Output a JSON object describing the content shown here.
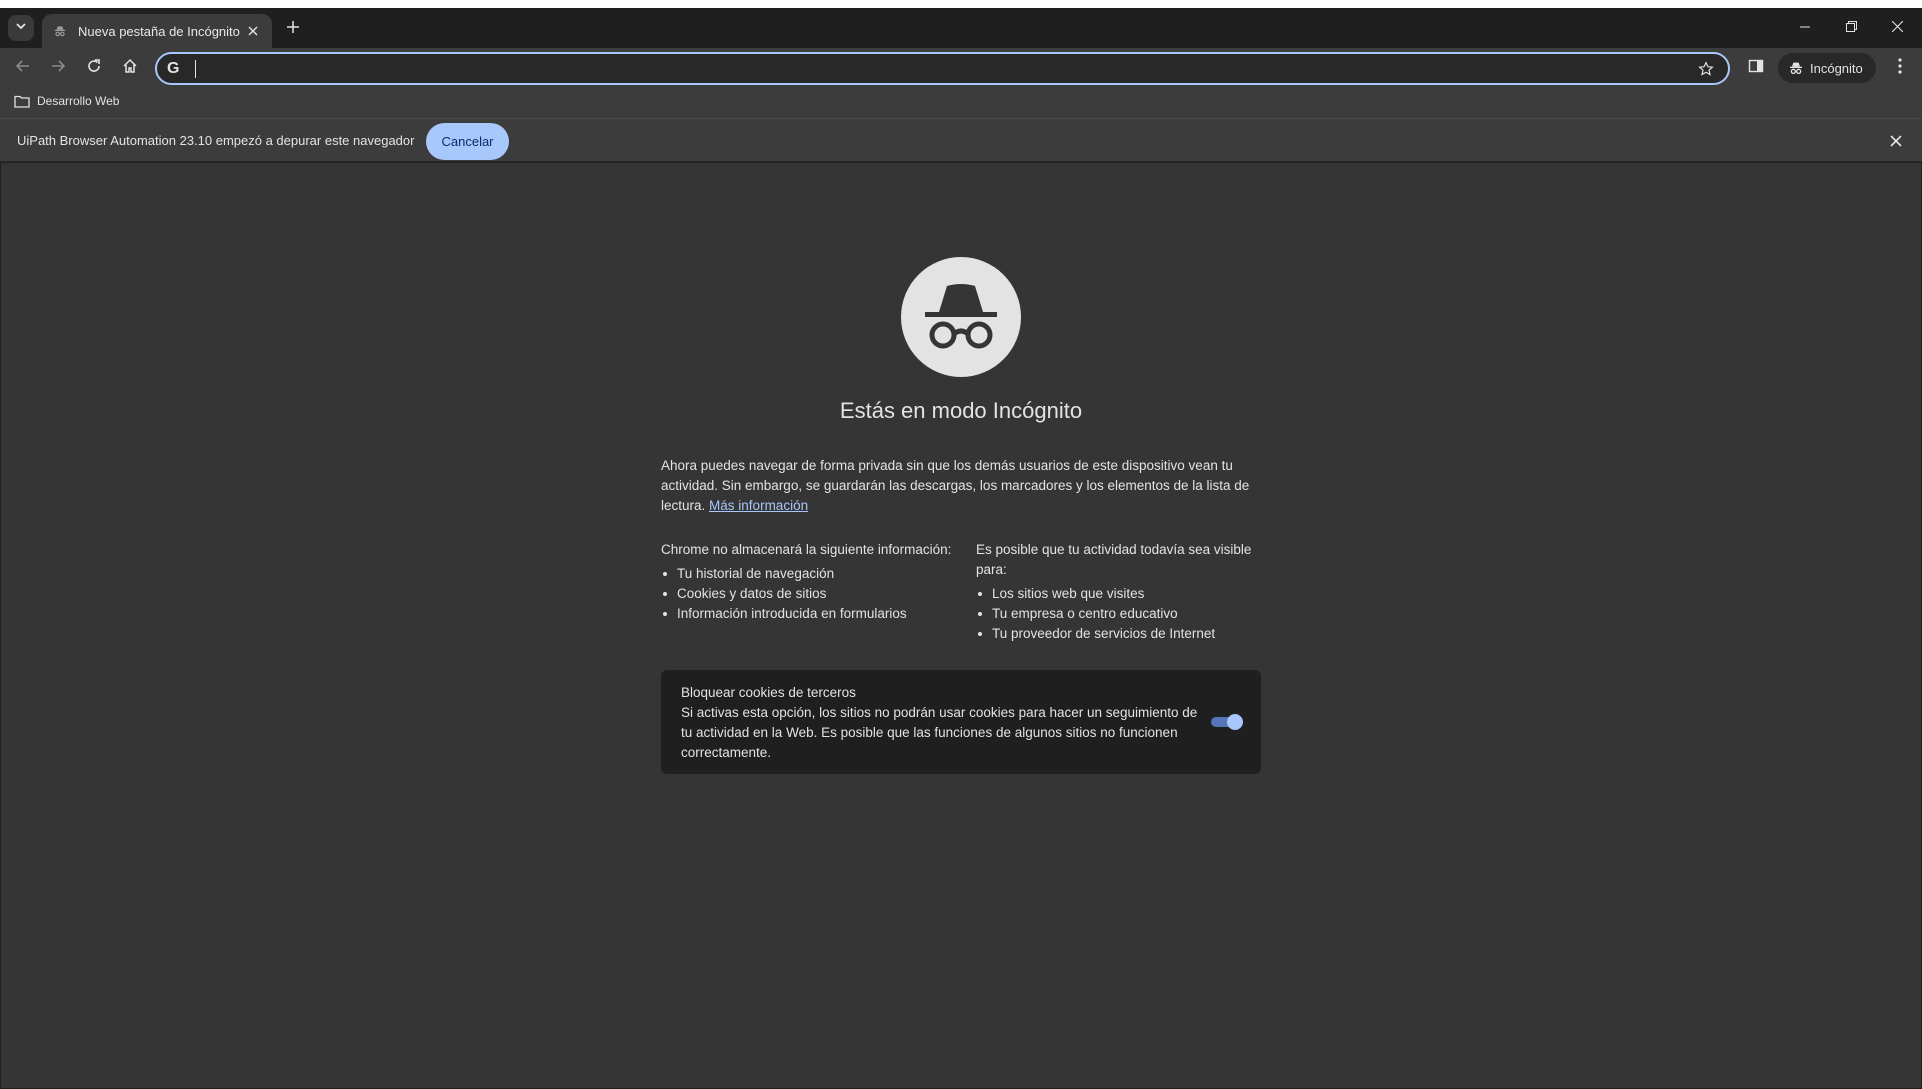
{
  "browser": {
    "tab": {
      "title": "Nueva pestaña de Incógnito"
    },
    "omnibox": {
      "value": "",
      "placeholder": ""
    },
    "profile_chip": "Incógnito",
    "bookmarks": [
      {
        "label": "Desarrollo Web"
      }
    ]
  },
  "infobar": {
    "message": "UiPath Browser Automation 23.10 empezó a depurar este navegador",
    "cancel_label": "Cancelar"
  },
  "page": {
    "heading": "Estás en modo Incógnito",
    "intro": "Ahora puedes navegar de forma privada sin que los demás usuarios de este dispositivo vean tu actividad. Sin embargo, se guardarán las descargas, los marcadores y los elementos de la lista de lectura.",
    "learn_more": "Más información",
    "left_col": {
      "heading": "Chrome no almacenará la siguiente información:",
      "items": [
        "Tu historial de navegación",
        "Cookies y datos de sitios",
        "Información introducida en formularios"
      ]
    },
    "right_col": {
      "heading": "Es posible que tu actividad todavía sea visible para:",
      "items": [
        "Los sitios web que visites",
        "Tu empresa o centro educativo",
        "Tu proveedor de servicios de Internet"
      ]
    },
    "cookies": {
      "title": "Bloquear cookies de terceros",
      "description": "Si activas esta opción, los sitios no podrán usar cookies para hacer un seguimiento de tu actividad en la Web. Es posible que las funciones de algunos sitios no funcionen correctamente.",
      "enabled": true
    }
  },
  "colors": {
    "accent": "#a8c7fa",
    "content_bg": "#353535",
    "toolbar_bg": "#3c3c3c"
  }
}
